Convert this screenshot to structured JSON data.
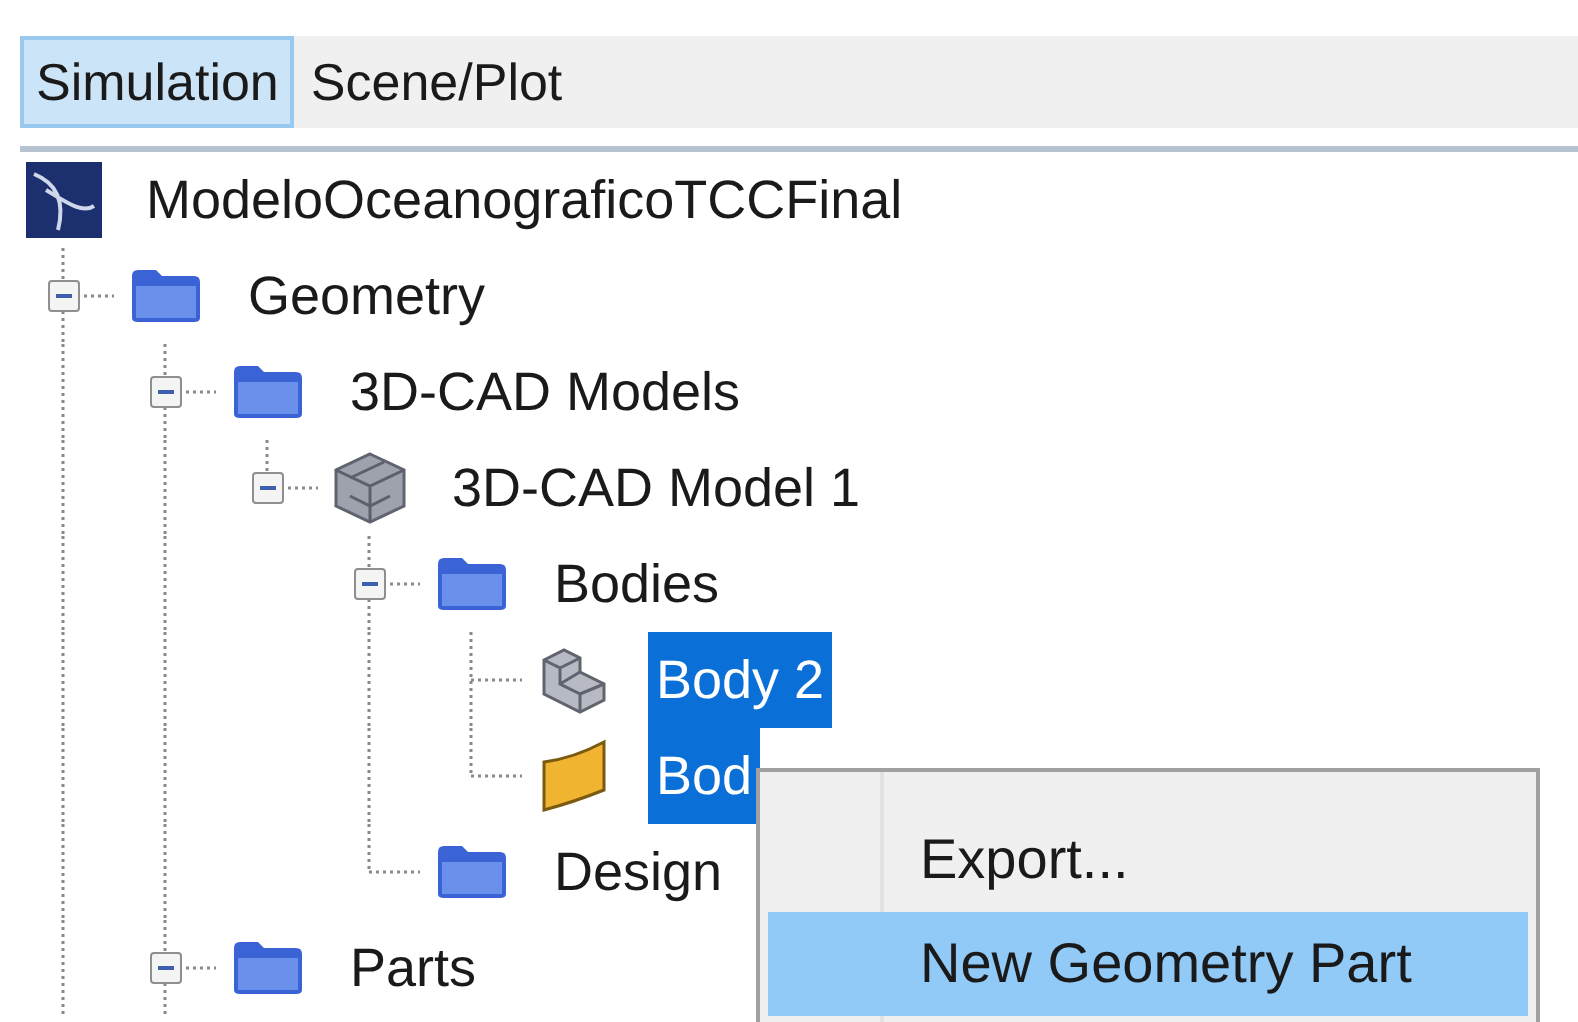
{
  "tabs": [
    {
      "label": "Simulation",
      "selected": true
    },
    {
      "label": "Scene/Plot",
      "selected": false
    }
  ],
  "tree": [
    {
      "label": "ModeloOceanograficoTCCFinal",
      "kind": "simulation",
      "selected": false,
      "children": [
        {
          "label": "Geometry",
          "kind": "folder",
          "expanded": true,
          "selected": false,
          "children": [
            {
              "label": "3D-CAD Models",
              "kind": "folder",
              "expanded": true,
              "selected": false,
              "children": [
                {
                  "label": "3D-CAD Model 1",
                  "kind": "cad-model",
                  "expanded": true,
                  "selected": false,
                  "children": [
                    {
                      "label": "Bodies",
                      "kind": "folder",
                      "expanded": true,
                      "selected": false,
                      "children": [
                        {
                          "label": "Body 2",
                          "kind": "solid-body",
                          "selected": true
                        },
                        {
                          "label": "Bod",
                          "kind": "sheet-body",
                          "selected": true
                        }
                      ]
                    },
                    {
                      "label": "Design",
                      "kind": "folder",
                      "selected": false
                    }
                  ]
                }
              ]
            },
            {
              "label": "Parts",
              "kind": "folder",
              "expanded": true,
              "selected": false
            }
          ]
        }
      ]
    }
  ],
  "context_menu": {
    "items": [
      {
        "label": "Export...",
        "highlighted": false
      },
      {
        "label": "New Geometry Part",
        "highlighted": true
      }
    ]
  }
}
